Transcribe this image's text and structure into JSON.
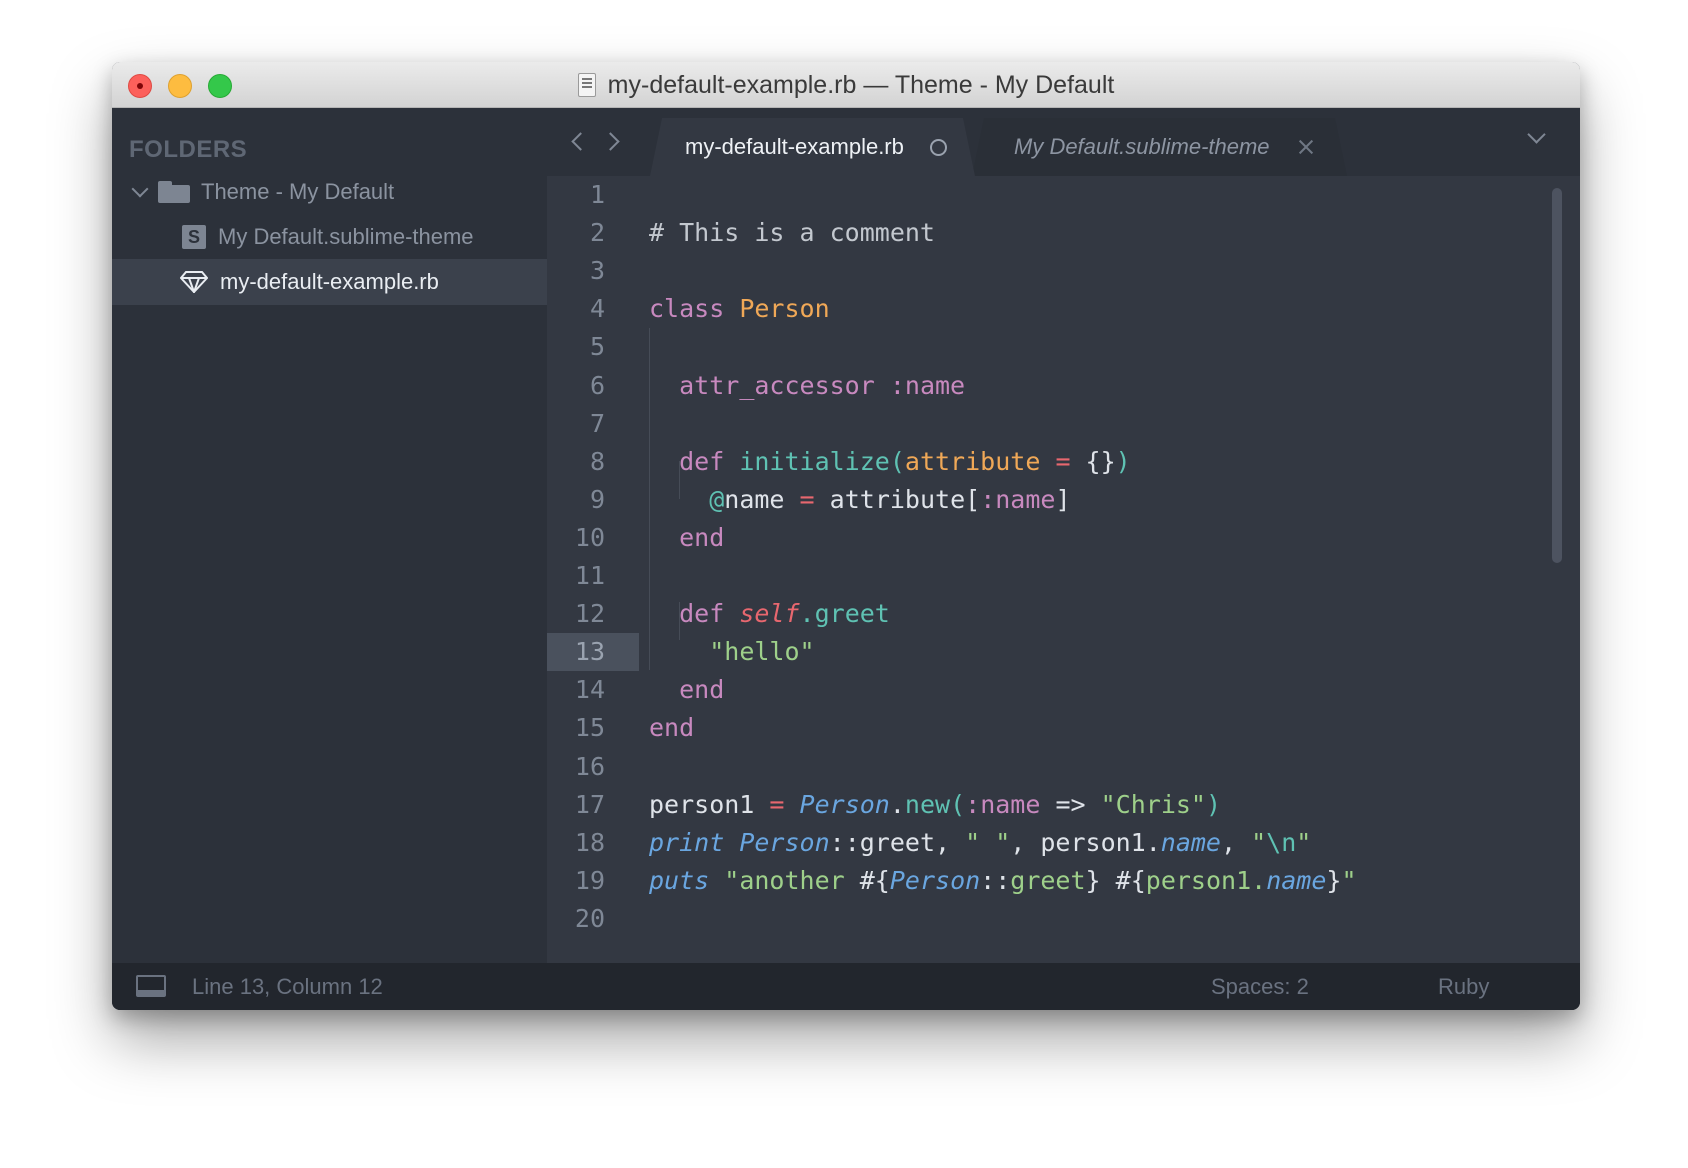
{
  "window": {
    "title": "my-default-example.rb — Theme - My Default"
  },
  "sidebar": {
    "header": "FOLDERS",
    "folder": {
      "name": "Theme - My Default",
      "expanded": true
    },
    "files": [
      {
        "name": "My Default.sublime-theme",
        "icon": "sublime-s-icon",
        "selected": false
      },
      {
        "name": "my-default-example.rb",
        "icon": "ruby-gem-icon",
        "selected": true
      }
    ]
  },
  "tabs": [
    {
      "label": "my-default-example.rb",
      "active": true,
      "dirty": true
    },
    {
      "label": "My Default.sublime-theme",
      "active": false,
      "dirty": false
    }
  ],
  "editor": {
    "current_line": 13,
    "lines": [
      {
        "num": "1",
        "tokens": []
      },
      {
        "num": "2",
        "tokens": [
          [
            "c-comment",
            "# This is a comment"
          ]
        ]
      },
      {
        "num": "3",
        "tokens": []
      },
      {
        "num": "4",
        "tokens": [
          [
            "c-kw",
            "class"
          ],
          [
            "c-punct",
            " "
          ],
          [
            "c-cls",
            "Person"
          ]
        ]
      },
      {
        "num": "5",
        "tokens": []
      },
      {
        "num": "6",
        "tokens": [
          [
            "c-punct",
            "  "
          ],
          [
            "c-kw",
            "attr_accessor"
          ],
          [
            "c-punct",
            " "
          ],
          [
            "c-sym",
            ":name"
          ]
        ]
      },
      {
        "num": "7",
        "tokens": []
      },
      {
        "num": "8",
        "tokens": [
          [
            "c-punct",
            "  "
          ],
          [
            "c-kw",
            "def"
          ],
          [
            "c-punct",
            " "
          ],
          [
            "c-fn",
            "initialize("
          ],
          [
            "c-param",
            "attribute"
          ],
          [
            "c-punct",
            " "
          ],
          [
            "c-op",
            "="
          ],
          [
            "c-punct",
            " {}"
          ],
          [
            "c-fn",
            ")"
          ]
        ]
      },
      {
        "num": "9",
        "tokens": [
          [
            "c-punct",
            "    "
          ],
          [
            "c-ivar",
            "@"
          ],
          [
            "c-punct",
            "name "
          ],
          [
            "c-op",
            "="
          ],
          [
            "c-punct",
            " attribute["
          ],
          [
            "c-sym",
            ":name"
          ],
          [
            "c-punct",
            "]"
          ]
        ]
      },
      {
        "num": "10",
        "tokens": [
          [
            "c-punct",
            "  "
          ],
          [
            "c-kw",
            "end"
          ]
        ]
      },
      {
        "num": "11",
        "tokens": []
      },
      {
        "num": "12",
        "tokens": [
          [
            "c-punct",
            "  "
          ],
          [
            "c-kw",
            "def"
          ],
          [
            "c-punct",
            " "
          ],
          [
            "c-self",
            "self"
          ],
          [
            "c-fn",
            ".greet"
          ]
        ]
      },
      {
        "num": "13",
        "tokens": [
          [
            "c-punct",
            "    "
          ],
          [
            "c-str",
            "\"hello\""
          ]
        ]
      },
      {
        "num": "14",
        "tokens": [
          [
            "c-punct",
            "  "
          ],
          [
            "c-kw",
            "end"
          ]
        ]
      },
      {
        "num": "15",
        "tokens": [
          [
            "c-kw",
            "end"
          ]
        ]
      },
      {
        "num": "16",
        "tokens": []
      },
      {
        "num": "17",
        "tokens": [
          [
            "c-punct",
            "person1 "
          ],
          [
            "c-op",
            "="
          ],
          [
            "c-punct",
            " "
          ],
          [
            "c-const",
            "Person"
          ],
          [
            "c-punct",
            "."
          ],
          [
            "c-method",
            "new("
          ],
          [
            "c-sym",
            ":name"
          ],
          [
            "c-punct",
            " => "
          ],
          [
            "c-str",
            "\"Chris\""
          ],
          [
            "c-method",
            ")"
          ]
        ]
      },
      {
        "num": "18",
        "tokens": [
          [
            "c-builtin",
            "print"
          ],
          [
            "c-punct",
            " "
          ],
          [
            "c-const",
            "Person"
          ],
          [
            "c-punct",
            "::greet, "
          ],
          [
            "c-str",
            "\" \""
          ],
          [
            "c-punct",
            ", person1."
          ],
          [
            "c-const",
            "name"
          ],
          [
            "c-punct",
            ", "
          ],
          [
            "c-str",
            "\""
          ],
          [
            "c-esc",
            "\\n"
          ],
          [
            "c-str",
            "\""
          ]
        ]
      },
      {
        "num": "19",
        "tokens": [
          [
            "c-builtin",
            "puts"
          ],
          [
            "c-punct",
            " "
          ],
          [
            "c-str",
            "\"another "
          ],
          [
            "c-punct",
            "#{"
          ],
          [
            "c-const",
            "Person"
          ],
          [
            "c-punct",
            "::"
          ],
          [
            "c-str",
            "greet"
          ],
          [
            "c-punct",
            "} #{"
          ],
          [
            "c-str",
            "person1."
          ],
          [
            "c-const",
            "name"
          ],
          [
            "c-punct",
            "}"
          ],
          [
            "c-str",
            "\""
          ]
        ]
      },
      {
        "num": "20",
        "tokens": []
      }
    ]
  },
  "statusbar": {
    "position": "Line 13, Column 12",
    "spaces": "Spaces: 2",
    "syntax": "Ruby"
  },
  "colors": {
    "sidebar_bg": "#2c313a",
    "editor_bg": "#333842",
    "statusbar_bg": "#22262d",
    "keyword": "#c889bf",
    "class_name": "#f0a857",
    "function": "#5fc2b3",
    "string": "#9ed08a",
    "constant": "#6aa6e0",
    "operator": "#e8676f"
  }
}
